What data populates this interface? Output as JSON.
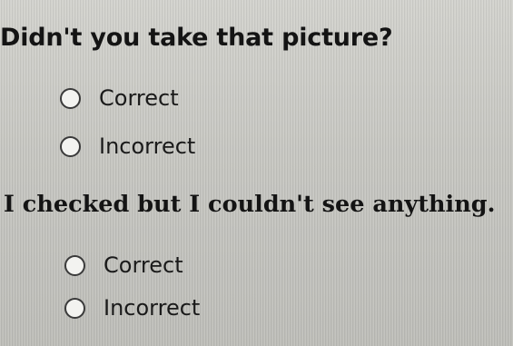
{
  "questions": [
    {
      "text": "Didn't you take that picture?",
      "options": [
        "Correct",
        "Incorrect"
      ]
    },
    {
      "text": "I checked but I couldn't see anything.",
      "options": [
        "Correct",
        "Incorrect"
      ]
    }
  ]
}
